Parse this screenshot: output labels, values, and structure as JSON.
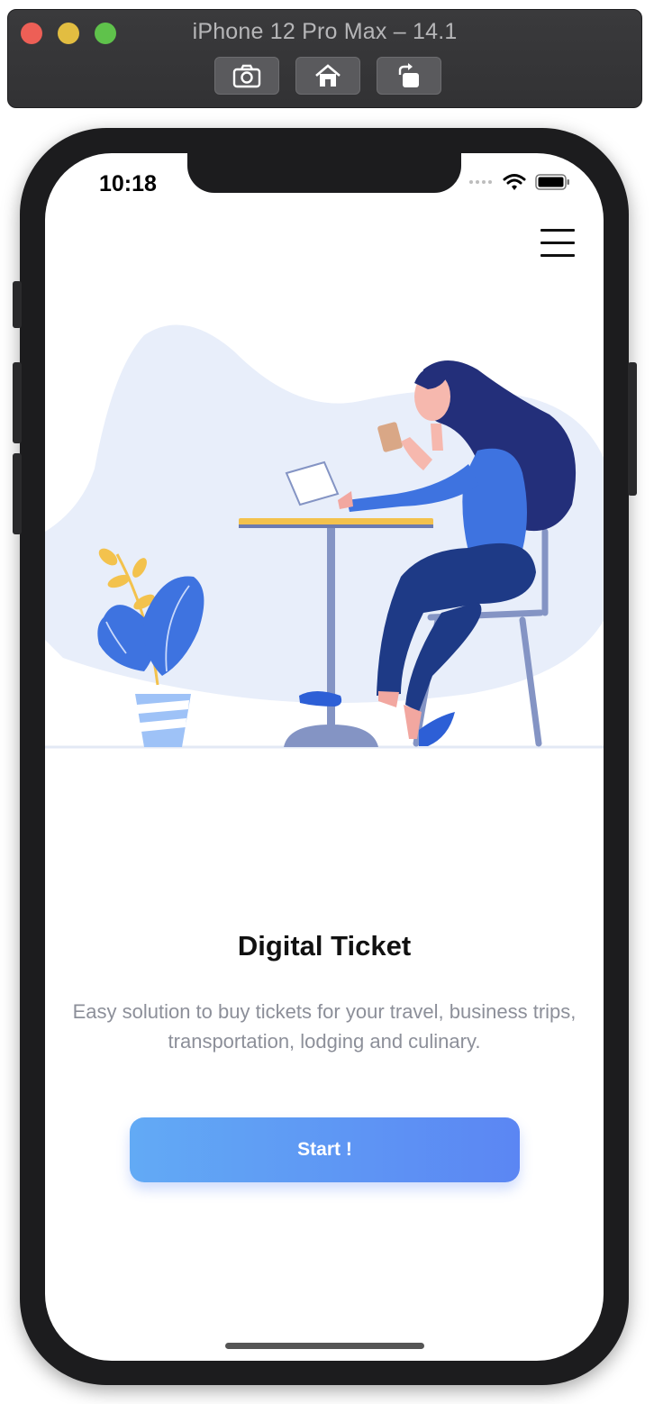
{
  "window": {
    "title": "iPhone 12 Pro Max – 14.1",
    "toolbar": [
      {
        "icon": "screenshot-icon"
      },
      {
        "icon": "home-icon"
      },
      {
        "icon": "rotate-icon"
      }
    ]
  },
  "status_bar": {
    "time": "10:18",
    "icons": [
      "signal-icon",
      "wifi-icon",
      "battery-icon"
    ]
  },
  "header": {
    "menu_icon": "hamburger-menu-icon"
  },
  "onboarding": {
    "title": "Digital Ticket",
    "subtitle": "Easy solution to buy tickets for your travel, business trips, transportation, lodging and culinary.",
    "cta_label": "Start !"
  },
  "colors": {
    "accent_start": "#62aaf5",
    "accent_end": "#5b86f3",
    "blob": "#e8eefa",
    "text_primary": "#111111",
    "text_secondary": "#8c8f99"
  }
}
